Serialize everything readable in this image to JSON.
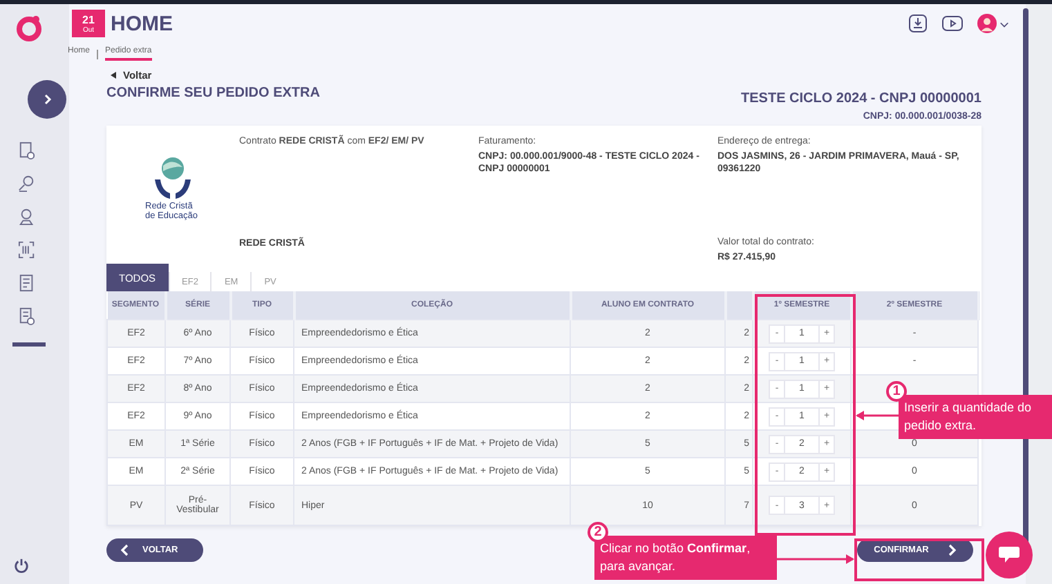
{
  "header": {
    "date_day": "21",
    "date_month": "Out",
    "title": "HOME",
    "breadcrumb": [
      {
        "label": "Home",
        "selected": false
      },
      {
        "label": "Pedido extra",
        "selected": true
      }
    ]
  },
  "back_link": "Voltar",
  "page_title": "CONFIRME SEU PEDIDO EXTRA",
  "client": {
    "name": "TESTE CICLO 2024 - CNPJ 00000001",
    "cnpj": "CNPJ: 00.000.001/0038-28"
  },
  "contract": {
    "logo_text": "Rede Cristã de Educação",
    "summary": "Contrato **REDE CRISTÃ** com **EF2/ EM/ PV**",
    "network": "REDE CRISTÃ",
    "billing_label": "Faturamento:",
    "billing_value": "CNPJ: 00.000.001/9000-48 - TESTE CICLO 2024 - CNPJ 00000001",
    "delivery_label": "Endereço de entrega:",
    "delivery_value": "DOS JASMINS, 26 - JARDIM PRIMAVERA, Mauá - SP, 09361220",
    "total_label": "Valor total do contrato:",
    "total_value": "R$ 27.415,90"
  },
  "tabs": [
    {
      "label": "TODOS",
      "selected": true
    },
    {
      "label": "EF2",
      "selected": false
    },
    {
      "label": "EM",
      "selected": false
    },
    {
      "label": "PV",
      "selected": false
    }
  ],
  "table": {
    "columns": [
      "SEGMENTO",
      "SÉRIE",
      "TIPO",
      "COLEÇÃO",
      "ALUNO EM CONTRATO",
      "",
      "1º SEMESTRE",
      "2º SEMESTRE"
    ],
    "rows": [
      {
        "segmento": "EF2",
        "serie": "6º Ano",
        "tipo": "Físico",
        "colecao": "Empreendedorismo e Ética",
        "aluno_em_contrato": "2",
        "column_6": "2",
        "decrement": "-",
        "semestre_1": "1",
        "increment": "+",
        "semestre_2": "-"
      },
      {
        "segmento": "EF2",
        "serie": "7º Ano",
        "tipo": "Físico",
        "colecao": "Empreendedorismo e Ética",
        "aluno_em_contrato": "2",
        "column_6": "2",
        "decrement": "-",
        "semestre_1": "1",
        "increment": "+",
        "semestre_2": "-"
      },
      {
        "segmento": "EF2",
        "serie": "8º Ano",
        "tipo": "Físico",
        "colecao": "Empreendedorismo e Ética",
        "aluno_em_contrato": "2",
        "column_6": "2",
        "decrement": "-",
        "semestre_1": "1",
        "increment": "+"
      },
      {
        "segmento": "EF2",
        "serie": "9º Ano",
        "tipo": "Físico",
        "colecao": "Empreendedorismo e Ética",
        "aluno_em_contrato": "2",
        "column_6": "2",
        "decrement": "-",
        "semestre_1": "1",
        "increment": "+"
      },
      {
        "segmento": "EM",
        "serie": "1ª Série",
        "tipo": "Físico",
        "colecao": "2 Anos (FGB + IF Português + IF de Mat. + Projeto de Vida)",
        "aluno_em_contrato": "5",
        "column_6": "5",
        "decrement": "-",
        "semestre_1": "2",
        "increment": "+",
        "semestre_2": "0"
      },
      {
        "segmento": "EM",
        "serie": "2ª Série",
        "tipo": "Físico",
        "colecao": "2 Anos (FGB + IF Português + IF de Mat. + Projeto de Vida)",
        "aluno_em_contrato": "5",
        "column_6": "5",
        "decrement": "-",
        "semestre_1": "2",
        "increment": "+",
        "semestre_2": "0"
      },
      {
        "segmento": "PV",
        "serie": "Pré-Vestibular",
        "tipo": "Físico",
        "colecao": "Hiper",
        "aluno_em_contrato": "10",
        "column_6": "7",
        "decrement": "-",
        "semestre_1": "3",
        "increment": "+",
        "semestre_2": "0"
      }
    ]
  },
  "buttons": {
    "back": "VOLTAR",
    "confirm": "CONFIRMAR"
  },
  "annotations": [
    {
      "number": "1",
      "text": "Inserir a quantidade do pedido extra."
    },
    {
      "number": "2",
      "text": "Clicar no botão **Confirmar**, para avançar."
    }
  ]
}
